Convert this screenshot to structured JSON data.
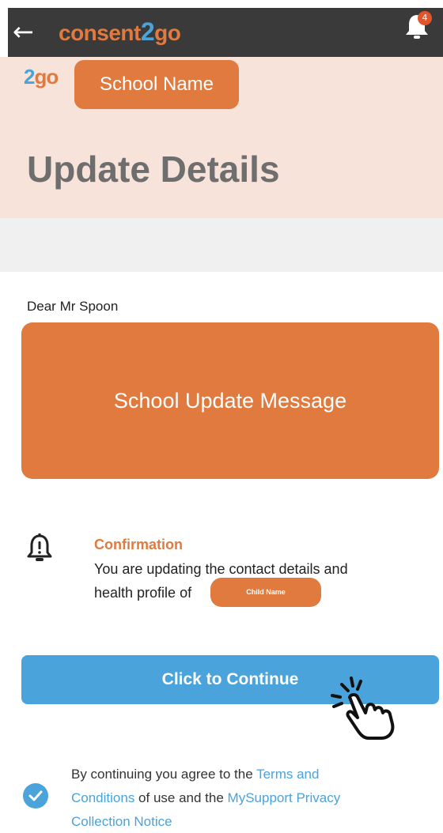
{
  "topbar": {
    "back_icon": "arrow-left-icon",
    "brand_part1": "consent",
    "brand_part2": "2",
    "brand_part3": "go",
    "notification_icon": "bell-icon",
    "notification_count": "4"
  },
  "header": {
    "logo_part1": "2",
    "logo_part2": "go",
    "school_name": "School Name",
    "title": "Update Details"
  },
  "main": {
    "greeting": "Dear Mr Spoon",
    "school_message": "School Update Message",
    "confirmation": {
      "icon": "bell-alert-icon",
      "title": "Confirmation",
      "line1": "You are updating the contact details and",
      "line2": "health profile of",
      "child_name": "Child Name"
    },
    "continue_label": "Click to Continue",
    "continue_icon": "pointing-hand-click-icon"
  },
  "agreement": {
    "check_icon": "checkmark-circle-icon",
    "text1": "By continuing you agree to the ",
    "link1a": "Terms and",
    "link1b": "Conditions",
    "text2": " of use and the ",
    "link2a": "MySupport Privacy",
    "link2b": "Collection Notice"
  },
  "colors": {
    "accent_orange": "#e07a3f",
    "accent_blue": "#4aa3da",
    "header_bg": "#f7e3da",
    "topbar_bg": "#3a3a3a"
  }
}
